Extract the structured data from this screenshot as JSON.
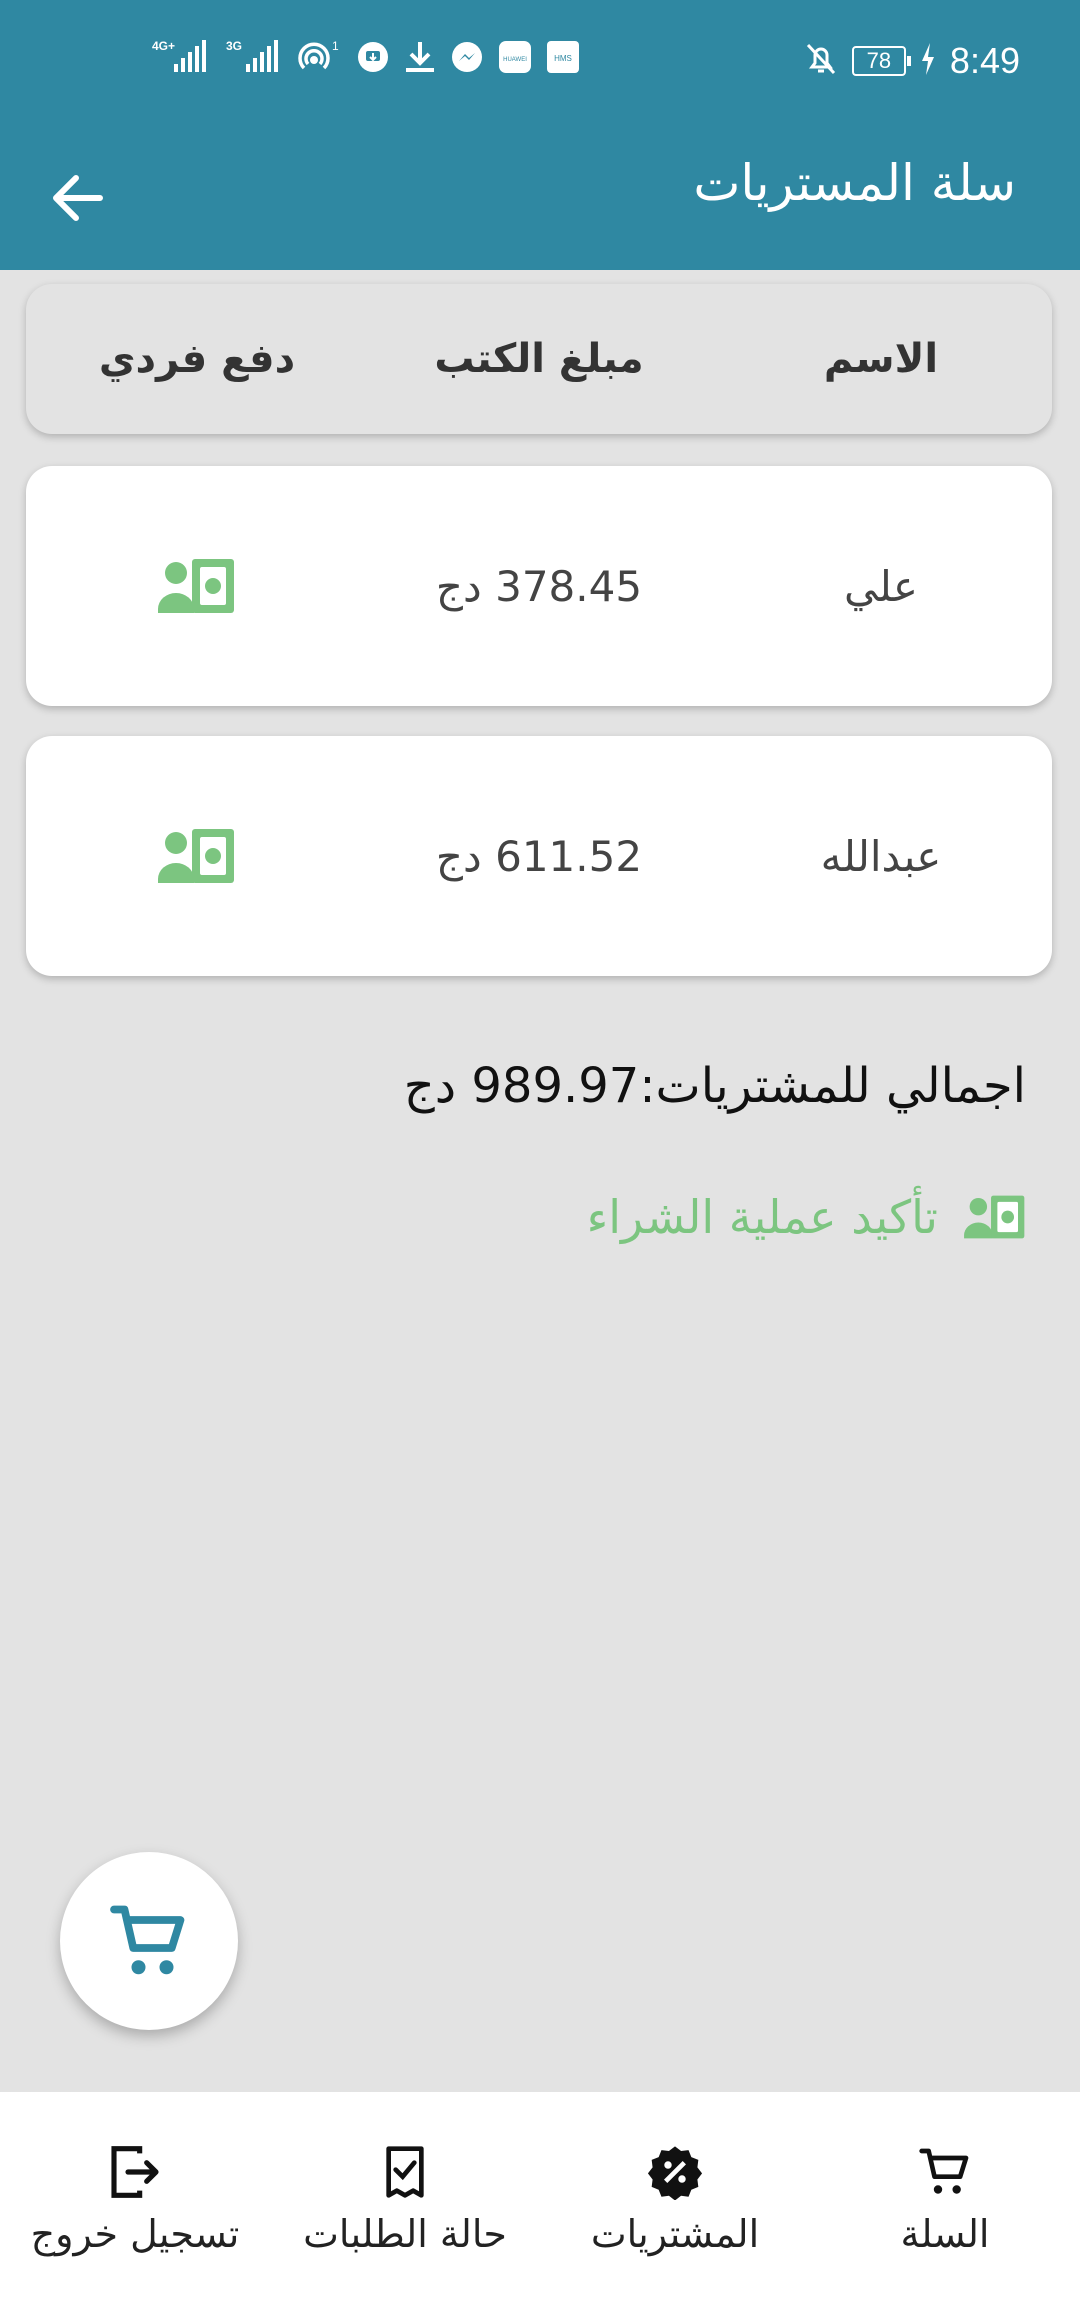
{
  "status_bar": {
    "time": "8:49",
    "battery": "78",
    "network_1": "4G+",
    "network_2": "3G",
    "hotspot_count": "1",
    "icons": [
      "signal-4g-icon",
      "signal-3g-icon",
      "hotspot-icon",
      "download-circle-icon",
      "download-icon",
      "messenger-icon",
      "huawei-icon",
      "hms-icon",
      "bell-off-icon",
      "battery-icon",
      "charging-icon"
    ]
  },
  "app_bar": {
    "title": "سلة المستريات",
    "back_icon": "arrow-left-icon"
  },
  "table": {
    "headers": {
      "name": "الاسم",
      "amount": "مبلغ الكتب",
      "pay": "دفع فردي"
    },
    "rows": [
      {
        "name": "علي",
        "amount": "378.45 دج",
        "icon": "pay-cash-icon"
      },
      {
        "name": "عبدالله",
        "amount": "611.52 دج",
        "icon": "pay-cash-icon"
      }
    ]
  },
  "total_text": "اجمالي للمشتريات:989.97 دج",
  "confirm_label": "تأكيد عملية الشراء",
  "colors": {
    "primary": "#2f88a2",
    "accent_green": "#7cc580",
    "background": "#e3e3e3"
  },
  "fab_icon": "cart-icon",
  "bottom_nav": [
    {
      "label": "السلة",
      "icon": "cart-icon"
    },
    {
      "label": "المشتريات",
      "icon": "discount-badge-icon"
    },
    {
      "label": "حالة الطلبات",
      "icon": "order-check-icon"
    },
    {
      "label": "تسجيل خروج",
      "icon": "logout-icon"
    }
  ]
}
